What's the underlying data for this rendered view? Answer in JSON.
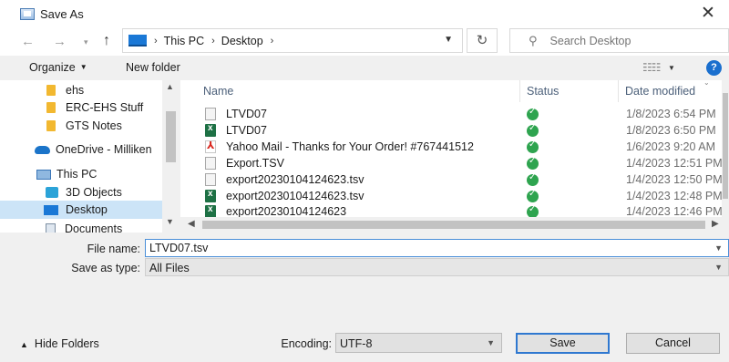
{
  "window": {
    "title": "Save As",
    "close_glyph": "✕"
  },
  "nav": {
    "back": "←",
    "forward": "→",
    "recent": "▾",
    "up": "↑",
    "breadcrumbs": [
      "This PC",
      "Desktop"
    ],
    "sep": "›",
    "refresh": "↻",
    "search_placeholder": "Search Desktop"
  },
  "toolbar": {
    "organize": "Organize",
    "new_folder": "New folder",
    "help": "?"
  },
  "sidebar": {
    "items": [
      {
        "label": "ehs",
        "icon": "folder-icon",
        "selected": false
      },
      {
        "label": "ERC-EHS Stuff",
        "icon": "folder-icon",
        "selected": false
      },
      {
        "label": "GTS Notes",
        "icon": "folder-icon",
        "selected": false
      },
      {
        "label": "OneDrive - Milliken",
        "icon": "onedrive-icon",
        "selected": false
      },
      {
        "label": "This PC",
        "icon": "this-pc-icon",
        "selected": false
      },
      {
        "label": "3D Objects",
        "icon": "3d-objects-icon",
        "selected": false
      },
      {
        "label": "Desktop",
        "icon": "desktop-icon",
        "selected": true
      },
      {
        "label": "Documents",
        "icon": "documents-icon",
        "selected": false
      }
    ]
  },
  "files": {
    "columns": {
      "name": "Name",
      "status": "Status",
      "date": "Date modified"
    },
    "rows": [
      {
        "name": "LTVD07",
        "type": "generic-file-icon",
        "date": "1/8/2023 6:54 PM"
      },
      {
        "name": "LTVD07",
        "type": "excel-file-icon",
        "date": "1/8/2023 6:50 PM"
      },
      {
        "name": "Yahoo Mail - Thanks for Your Order! #767441512",
        "type": "pdf-file-icon",
        "date": "1/6/2023 9:20 AM"
      },
      {
        "name": "Export.TSV",
        "type": "generic-file-icon",
        "date": "1/4/2023 12:51 PM"
      },
      {
        "name": "export20230104124623.tsv",
        "type": "generic-file-icon",
        "date": "1/4/2023 12:50 PM"
      },
      {
        "name": "export20230104124623.tsv",
        "type": "excel-file-icon",
        "date": "1/4/2023 12:48 PM"
      },
      {
        "name": "export20230104124623",
        "type": "excel-file-icon",
        "date": "1/4/2023 12:46 PM"
      }
    ]
  },
  "form": {
    "file_name_label": "File name:",
    "file_name_value": "LTVD07.tsv",
    "save_type_label": "Save as type:",
    "save_type_value": "All Files",
    "hide_folders": "Hide Folders",
    "encoding_label": "Encoding:",
    "encoding_value": "UTF-8",
    "save_button": "Save",
    "cancel_button": "Cancel"
  }
}
